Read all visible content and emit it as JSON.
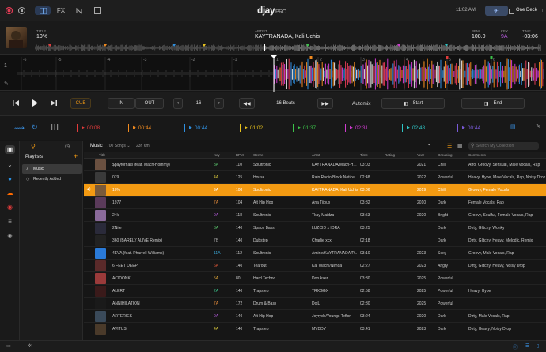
{
  "app": {
    "logo": "djay",
    "logo_suffix": "PRO",
    "clock": "11:02 AM",
    "deck_mode": "One Deck"
  },
  "topbar": {
    "fx_label": "FX"
  },
  "track": {
    "title_label": "TITLE",
    "title": "10%",
    "artist_label": "ARTIST",
    "artist": "KAYTRANADA, Kali Uchis",
    "bpm_label": "BPM",
    "bpm": "108.0",
    "key_label": "KEY",
    "key": "9A",
    "time_label": "TIME",
    "time": "-03:06"
  },
  "ruler": {
    "labels": [
      "-6",
      "-5",
      "-4",
      "-3",
      "-2",
      "-1",
      "1",
      "2",
      "3",
      "4",
      "5",
      "6"
    ],
    "deck_number": "1"
  },
  "controls": {
    "cue": "CUE",
    "in": "IN",
    "out": "OUT",
    "loop_value": "16",
    "beats_value": "16 Beats",
    "automix": "Automix",
    "start": "Start",
    "end": "End"
  },
  "cues": [
    {
      "time": "00:08",
      "color": "#e23b3b"
    },
    {
      "time": "00:44",
      "color": "#f08a1f"
    },
    {
      "time": "00:44",
      "color": "#2f8fdf"
    },
    {
      "time": "01:02",
      "color": "#e8c21d"
    },
    {
      "time": "01:37",
      "color": "#3cc34a"
    },
    {
      "time": "02:31",
      "color": "#d03bd0"
    },
    {
      "time": "02:48",
      "color": "#2fc6c6"
    },
    {
      "time": "00:44",
      "color": "#7a5ad8"
    }
  ],
  "playlists": {
    "title": "Playlists",
    "items": [
      "Music",
      "Recently Added"
    ]
  },
  "library": {
    "name": "Music",
    "count": "700 Songs",
    "duration": "23h 6m",
    "search_placeholder": "Search My Collection",
    "columns": [
      "Title",
      "Key",
      "BPM",
      "Genre",
      "Artist",
      "Time",
      "Rating",
      "Year",
      "Grouping",
      "Comments"
    ],
    "rows": [
      {
        "title": "$payforhaiti (feat. Mach-Hommy)",
        "key": "3A",
        "key_color": "#59c26b",
        "bpm": "110",
        "genre": "Soultronic",
        "artist": "KAYTRANADA/Mach-H...",
        "time": "03:03",
        "year": "2021",
        "grouping": "Chill",
        "comments": "Afro, Groovy, Sensual, Male Vocals, Rap",
        "art": "#6a5040"
      },
      {
        "title": "079",
        "key": "4A",
        "key_color": "#d2c23a",
        "bpm": "125",
        "genre": "House",
        "artist": "Rain Radio/Block Notice",
        "time": "02:48",
        "year": "2022",
        "grouping": "Powerful",
        "comments": "Heavy, Hype, Male Vocals, Rap, Noisy Drop",
        "art": "#3a3a3a"
      },
      {
        "title": "10%",
        "key": "9A",
        "key_color": "#ffffff",
        "bpm": "108",
        "genre": "Soultronic",
        "artist": "KAYTRANADA, Kali Uchis",
        "time": "03:06",
        "year": "2019",
        "grouping": "Chill",
        "comments": "Groovy, Female Vocals",
        "art": "#7a5a3a"
      },
      {
        "title": "1977",
        "key": "7A",
        "key_color": "#e28a3a",
        "bpm": "104",
        "genre": "Alt Hip Hop",
        "artist": "Ana Tijoux",
        "time": "03:32",
        "year": "2010",
        "grouping": "Dark",
        "comments": "Female Vocals, Rap",
        "art": "#5a3a5a"
      },
      {
        "title": "24k",
        "key": "9A",
        "key_color": "#b25ad8",
        "bpm": "118",
        "genre": "Soultronic",
        "artist": "Tkay Maidza",
        "time": "03:53",
        "year": "2020",
        "grouping": "Bright",
        "comments": "Groovy, Soulful, Female Vocals, Rap",
        "art": "#8a6a9a"
      },
      {
        "title": "2Nite",
        "key": "3A",
        "key_color": "#59c26b",
        "bpm": "140",
        "genre": "Space Bass",
        "artist": "LUZCID x IORA",
        "time": "03:25",
        "year": "",
        "grouping": "Dark",
        "comments": "Dirty, Glitchy, Wonky",
        "art": "#2a2a3a"
      },
      {
        "title": "360 (BARELY ALIVE Remix)",
        "key": "7B",
        "key_color": "#aaaaaa",
        "bpm": "140",
        "genre": "Dubstep",
        "artist": "Charlie xcx",
        "time": "02:18",
        "year": "",
        "grouping": "Dark",
        "comments": "Dirty, Glitchy, Heavy, Melodic, Remix",
        "art": "#222222"
      },
      {
        "title": "4EVA (feat. Pharrell Williams)",
        "key": "11A",
        "key_color": "#3aa8d8",
        "bpm": "112",
        "genre": "Soultronic",
        "artist": "Amine/KAYTRANADA/P...",
        "time": "03:10",
        "year": "2023",
        "grouping": "Sexy",
        "comments": "Groovy, Male Vocals, Rap",
        "art": "#2a7ad8"
      },
      {
        "title": "6 FEET DEEP",
        "key": "6A",
        "key_color": "#e25a3a",
        "bpm": "140",
        "genre": "Tearout",
        "artist": "Kai Wachi/Nimda",
        "time": "02:27",
        "year": "2023",
        "grouping": "Angry",
        "comments": "Dirty, Glitchy, Heavy, Noisy Drop",
        "art": "#5a2a2a"
      },
      {
        "title": "ACIDONK",
        "key": "5A",
        "key_color": "#e2a83a",
        "bpm": "80",
        "genre": "Hard Techno",
        "artist": "Doruksen",
        "time": "03:30",
        "year": "2025",
        "grouping": "Powerful",
        "comments": "",
        "art": "#9a3a3a"
      },
      {
        "title": "ALERT",
        "key": "2A",
        "key_color": "#3ac28a",
        "bpm": "140",
        "genre": "Trapstep",
        "artist": "TRXGGX",
        "time": "02:58",
        "year": "2025",
        "grouping": "Powerful",
        "comments": "Heavy, Hype",
        "art": "#3a1a1a"
      },
      {
        "title": "ANNIHILATION",
        "key": "7A",
        "key_color": "#e28a3a",
        "bpm": "172",
        "genre": "Drum & Bass",
        "artist": "DoiL",
        "time": "02:30",
        "year": "2025",
        "grouping": "Powerful",
        "comments": "",
        "art": "#1a1a1a"
      },
      {
        "title": "ARTERIES",
        "key": "9A",
        "key_color": "#b25ad8",
        "bpm": "140",
        "genre": "Alt Hip Hop",
        "artist": "Joyryde/Youngs Teflon",
        "time": "03:24",
        "year": "2020",
        "grouping": "Dark",
        "comments": "Dirty, Male Vocals, Rap",
        "art": "#3a4a5a"
      },
      {
        "title": "AVITUS",
        "key": "4A",
        "key_color": "#d2c23a",
        "bpm": "140",
        "genre": "Trapstep",
        "artist": "MYDDY",
        "time": "03:41",
        "year": "2023",
        "grouping": "Dark",
        "comments": "Dirty, Heavy, Noisy Drop",
        "art": "#4a3a2a"
      }
    ]
  }
}
